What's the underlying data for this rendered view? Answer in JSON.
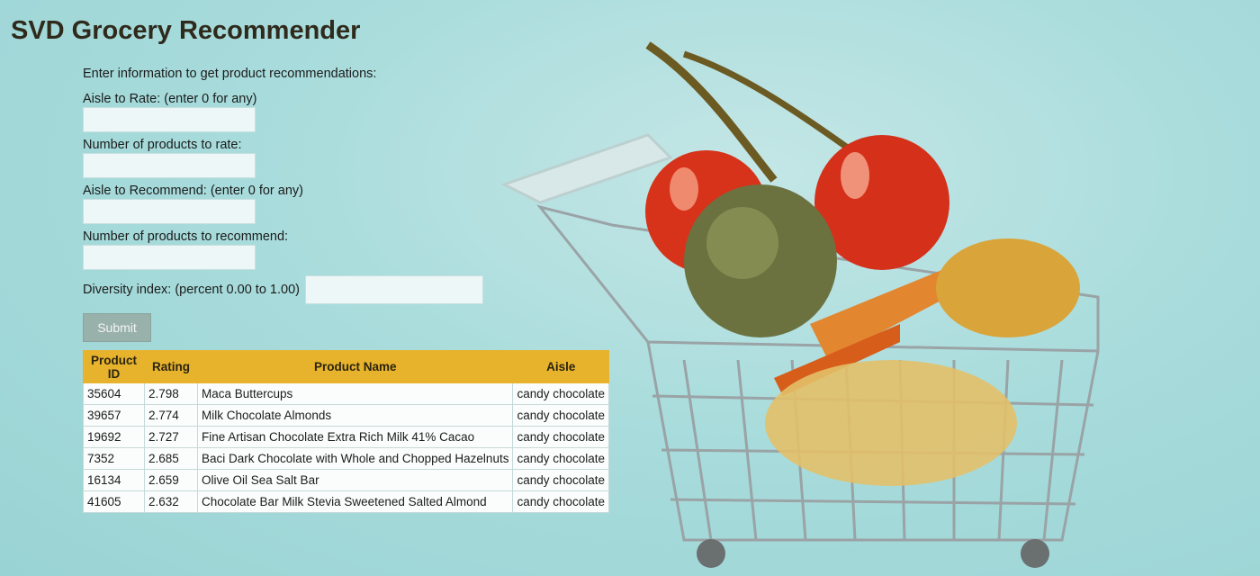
{
  "page": {
    "title": "SVD Grocery Recommender"
  },
  "form": {
    "intro": "Enter information to get product recommendations:",
    "fields": [
      {
        "label": "Aisle to Rate: (enter 0 for any)",
        "value": ""
      },
      {
        "label": "Number of products to rate:",
        "value": ""
      },
      {
        "label": "Aisle to Recommend: (enter 0 for any)",
        "value": ""
      },
      {
        "label": "Number of products to recommend:",
        "value": ""
      }
    ],
    "diversity": {
      "label": "Diversity index: (percent 0.00 to 1.00)",
      "value": ""
    },
    "submit_label": "Submit"
  },
  "table": {
    "headers": [
      "Product ID",
      "Rating",
      "Product Name",
      "Aisle"
    ],
    "rows": [
      [
        "35604",
        "2.798",
        "Maca Buttercups",
        "candy chocolate"
      ],
      [
        "39657",
        "2.774",
        "Milk Chocolate Almonds",
        "candy chocolate"
      ],
      [
        "19692",
        "2.727",
        "Fine Artisan Chocolate Extra Rich Milk 41% Cacao",
        "candy chocolate"
      ],
      [
        "7352",
        "2.685",
        "Baci Dark Chocolate with Whole and Chopped Hazelnuts",
        "candy chocolate"
      ],
      [
        "16134",
        "2.659",
        "Olive Oil Sea Salt Bar",
        "candy chocolate"
      ],
      [
        "41605",
        "2.632",
        "Chocolate Bar Milk Stevia Sweetened Salted Almond",
        "candy chocolate"
      ]
    ]
  },
  "colors": {
    "table_header": "#e8b32c",
    "background": "#a9dcdc",
    "submit": "#98b1aa"
  },
  "background_image": "shopping-cart-with-vegetables"
}
